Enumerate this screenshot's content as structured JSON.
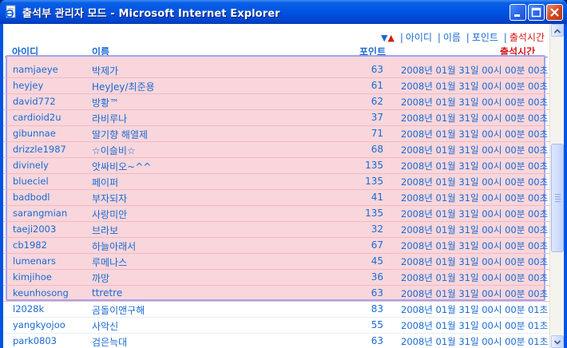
{
  "window": {
    "title": "출석부 관리자 모드 - Microsoft Internet Explorer"
  },
  "sortbar": {
    "down_arrow": "▼",
    "up_arrow": "▲",
    "links": [
      "아이디",
      "이름",
      "포인트",
      "출석시간"
    ],
    "active": "출석시간"
  },
  "table": {
    "headers": {
      "id": "아이디",
      "name": "이름",
      "point": "포인트",
      "time": "출석시간"
    },
    "rows": [
      {
        "id": "namjaeye",
        "name": "박제가",
        "point": "63",
        "time": "2008년 01월 31일 00시 00분 00초",
        "highlighted": true
      },
      {
        "id": "heyjey",
        "name": "HeyJey/최준용",
        "point": "61",
        "time": "2008년 01월 31일 00시 00분 00초",
        "highlighted": true
      },
      {
        "id": "david772",
        "name": "방황™",
        "point": "62",
        "time": "2008년 01월 31일 00시 00분 00초",
        "highlighted": true
      },
      {
        "id": "cardioid2u",
        "name": "라비루나",
        "point": "37",
        "time": "2008년 01월 31일 00시 00분 00초",
        "highlighted": true
      },
      {
        "id": "gibunnae",
        "name": "딸기향 해열제",
        "point": "71",
        "time": "2008년 01월 31일 00시 00분 00초",
        "highlighted": true
      },
      {
        "id": "drizzle1987",
        "name": "☆이슬비☆",
        "point": "68",
        "time": "2008년 01월 31일 00시 00분 00초",
        "highlighted": true
      },
      {
        "id": "divinely",
        "name": "앗싸비오~^^",
        "point": "135",
        "time": "2008년 01월 31일 00시 00분 00초",
        "highlighted": true
      },
      {
        "id": "blueciel",
        "name": "페이퍼",
        "point": "135",
        "time": "2008년 01월 31일 00시 00분 00초",
        "highlighted": true
      },
      {
        "id": "badbodl",
        "name": "부자되자",
        "point": "41",
        "time": "2008년 01월 31일 00시 00분 00초",
        "highlighted": true
      },
      {
        "id": "sarangmian",
        "name": "사랑미안",
        "point": "135",
        "time": "2008년 01월 31일 00시 00분 00초",
        "highlighted": true
      },
      {
        "id": "taeji2003",
        "name": "브라보",
        "point": "32",
        "time": "2008년 01월 31일 00시 00분 00초",
        "highlighted": true
      },
      {
        "id": "cb1982",
        "name": "하늘아래서",
        "point": "67",
        "time": "2008년 01월 31일 00시 00분 00초",
        "highlighted": true
      },
      {
        "id": "lumenars",
        "name": "루메나스",
        "point": "45",
        "time": "2008년 01월 31일 00시 00분 00초",
        "highlighted": true
      },
      {
        "id": "kimjihoe",
        "name": "까망",
        "point": "36",
        "time": "2008년 01월 31일 00시 00분 00초",
        "highlighted": true
      },
      {
        "id": "keunhosong",
        "name": "ttretre",
        "point": "63",
        "time": "2008년 01월 31일 00시 00분 00초",
        "highlighted": true
      },
      {
        "id": "l2028k",
        "name": "곰돌이앤구해",
        "point": "83",
        "time": "2008년 01월 31일 00시 00분 01초",
        "highlighted": false
      },
      {
        "id": "yangkyojoo",
        "name": "사악신",
        "point": "55",
        "time": "2008년 01월 31일 00시 00분 01초",
        "highlighted": false
      },
      {
        "id": "park0803",
        "name": "검은늑대",
        "point": "63",
        "time": "2008년 01월 31일 00시 00분 01초",
        "highlighted": false
      }
    ]
  },
  "colors": {
    "link_blue": "#1a6ad2",
    "active_red": "#d61a1a",
    "highlight_bg": "#f8d6dc",
    "highlight_border": "#9fa6f0",
    "titlebar": "#0055e5"
  },
  "icons": {
    "window_icon": "ie-page-icon",
    "minimize": "minimize-icon",
    "maximize": "maximize-icon",
    "close": "close-icon"
  }
}
